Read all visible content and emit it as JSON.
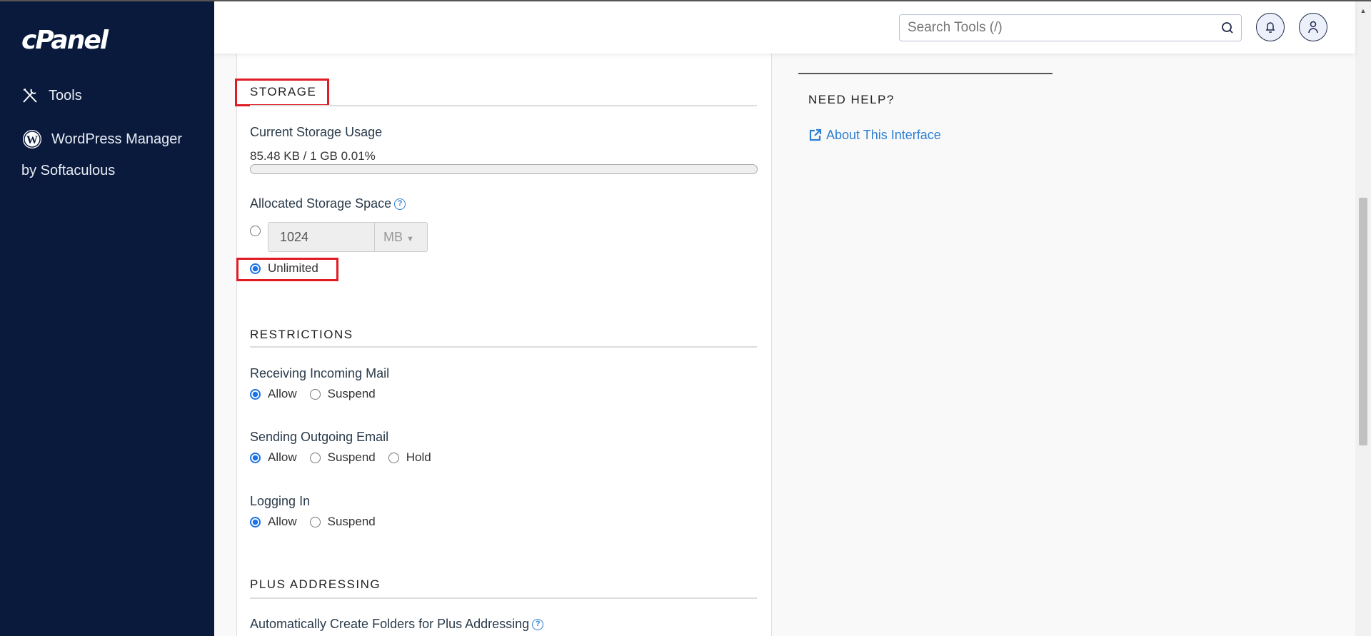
{
  "sidebar": {
    "logo": "cPanel",
    "items": [
      {
        "label": "Tools",
        "icon": "tools-icon"
      },
      {
        "label": "WordPress Manager",
        "label2": "by Softaculous",
        "icon": "wordpress-icon"
      }
    ]
  },
  "header": {
    "search_placeholder": "Search Tools (/)"
  },
  "storage": {
    "heading": "STORAGE",
    "usage_label": "Current Storage Usage",
    "usage_text": "85.48 KB / 1 GB 0.01%",
    "usage_percent": 0.01,
    "allocated_label": "Allocated Storage Space",
    "quota_value": "1024",
    "unit": "MB",
    "unlimited_label": "Unlimited",
    "selected": "Unlimited"
  },
  "restrictions": {
    "heading": "RESTRICTIONS",
    "groups": [
      {
        "label": "Receiving Incoming Mail",
        "options": [
          "Allow",
          "Suspend"
        ],
        "selected": "Allow"
      },
      {
        "label": "Sending Outgoing Email",
        "options": [
          "Allow",
          "Suspend",
          "Hold"
        ],
        "selected": "Allow"
      },
      {
        "label": "Logging In",
        "options": [
          "Allow",
          "Suspend"
        ],
        "selected": "Allow"
      }
    ]
  },
  "plus": {
    "heading": "PLUS ADDRESSING",
    "auto_label": "Automatically Create Folders for Plus Addressing"
  },
  "help": {
    "heading": "NEED HELP?",
    "link": "About This Interface"
  },
  "colors": {
    "sidebar": "#0a1a3c",
    "accent": "#1a73e8",
    "highlight": "#e01b24",
    "link": "#2f7fd0"
  }
}
